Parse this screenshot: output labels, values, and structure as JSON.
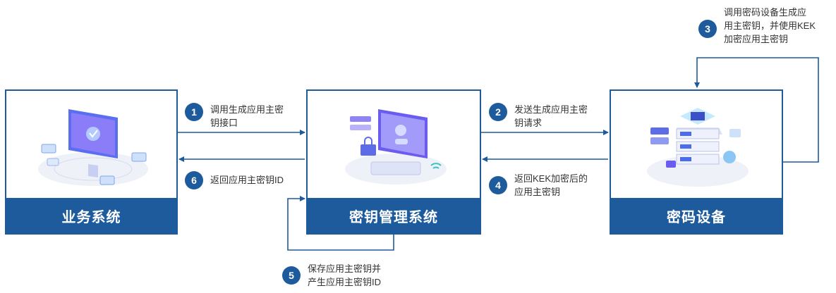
{
  "boxes": {
    "business": {
      "label": "业务系统"
    },
    "kms": {
      "label": "密钥管理系统"
    },
    "crypto": {
      "label": "密码设备"
    }
  },
  "steps": [
    {
      "num": "1",
      "text": "调用生成应用主密\n钥接口"
    },
    {
      "num": "2",
      "text": "发送生成应用主密\n钥请求"
    },
    {
      "num": "3",
      "text": "调用密码设备生成应\n用主密钥，并使用KEK\n加密应用主密钥"
    },
    {
      "num": "4",
      "text": "返回KEK加密后的\n应用主密钥"
    },
    {
      "num": "5",
      "text": "保存应用主密钥并\n产生应用主密钥ID"
    },
    {
      "num": "6",
      "text": "返回应用主密钥ID"
    }
  ],
  "colors": {
    "primary": "#1d5b9c",
    "accent": "#6a5cf0"
  }
}
